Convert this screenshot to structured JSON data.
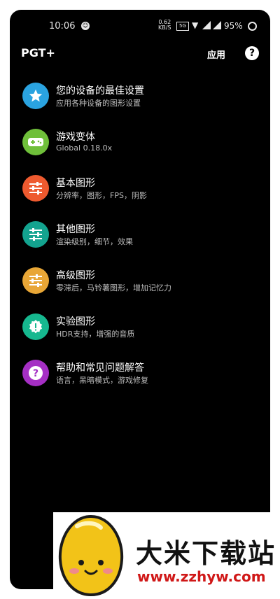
{
  "status_bar": {
    "time": "10:06",
    "net_speed_top": "0.62",
    "net_speed_bottom": "KB/S",
    "sim_label": "5G",
    "battery": "95%"
  },
  "app_bar": {
    "title": "PGT+",
    "apply_label": "应用",
    "help_glyph": "?"
  },
  "menu": {
    "items": [
      {
        "title": "您的设备的最佳设置",
        "subtitle": "应用各种设备的图形设置",
        "icon": "star-icon",
        "color": "#2aa3e0"
      },
      {
        "title": "游戏变体",
        "subtitle": "Global 0.18.0x",
        "icon": "gamepad-icon",
        "color": "#6fbf3a"
      },
      {
        "title": "基本图形",
        "subtitle": "分辨率，图形，FPS，阴影",
        "icon": "sliders-icon",
        "color": "#ee5a2f"
      },
      {
        "title": "其他图形",
        "subtitle": "渲染级别，细节，效果",
        "icon": "sliders-icon",
        "color": "#13a38f"
      },
      {
        "title": "高级图形",
        "subtitle": "零滞后，马铃薯图形，增加记忆力",
        "icon": "sliders-icon",
        "color": "#e8a636"
      },
      {
        "title": "实验图形",
        "subtitle": "HDR支持，增强的音质",
        "icon": "alert-icon",
        "color": "#16b88f"
      },
      {
        "title": "帮助和常见问题解答",
        "subtitle": "语言，黑暗模式，游戏修复",
        "icon": "help-icon",
        "color": "#a52fc4"
      }
    ]
  },
  "watermark": {
    "title": "大米下载站",
    "url": "www.zzhyw.com"
  }
}
